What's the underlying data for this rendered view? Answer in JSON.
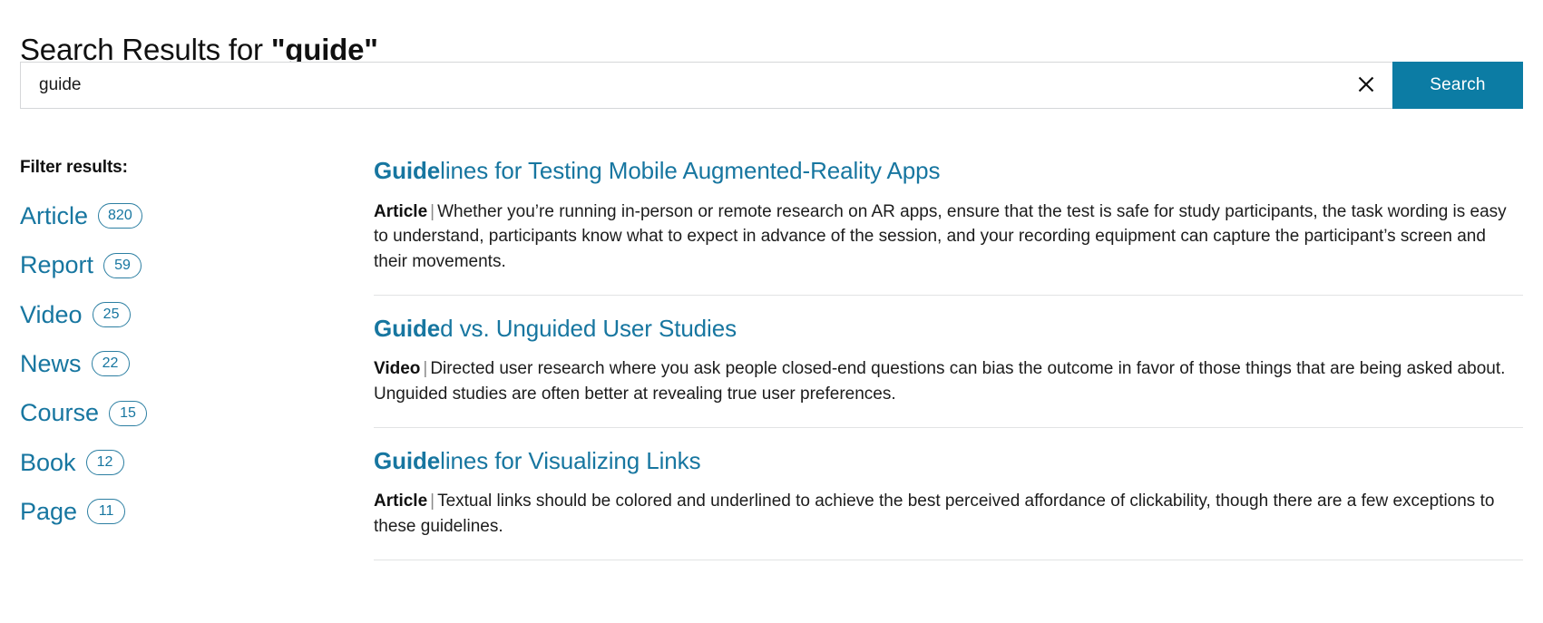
{
  "header": {
    "title_prefix": "Search Results for ",
    "query_quoted": "\"guide\""
  },
  "search": {
    "value": "guide",
    "placeholder": "Search",
    "clear_icon": "close-x-icon",
    "submit_label": "Search",
    "accent_color": "#0c7ca4"
  },
  "sidebar": {
    "heading": "Filter results:",
    "items": [
      {
        "label": "Article",
        "count": "820"
      },
      {
        "label": "Report",
        "count": "59"
      },
      {
        "label": "Video",
        "count": "25"
      },
      {
        "label": "News",
        "count": "22"
      },
      {
        "label": "Course",
        "count": "15"
      },
      {
        "label": "Book",
        "count": "12"
      },
      {
        "label": "Page",
        "count": "11"
      }
    ],
    "link_color": "#1776a0"
  },
  "results": [
    {
      "title_hit": "Guide",
      "title_rest": "lines for Testing Mobile Augmented-Reality Apps",
      "type": "Article",
      "separator": "|",
      "description": "Whether you’re running in-person or remote research on AR apps, ensure that the test is safe for study participants, the task wording is easy to understand, participants know what to expect in advance of the session, and your recording equipment can capture the participant’s screen and their movements."
    },
    {
      "title_hit": "Guide",
      "title_rest": "d vs. Unguided User Studies",
      "type": "Video",
      "separator": "|",
      "description": "Directed user research where you ask people closed-end questions can bias the outcome in favor of those things that are being asked about. Unguided studies are often better at revealing true user preferences."
    },
    {
      "title_hit": "Guide",
      "title_rest": "lines for Visualizing Links",
      "type": "Article",
      "separator": "|",
      "description": "Textual links should be colored and underlined to achieve the best perceived affordance of clickability, though there are a few exceptions to these guidelines."
    }
  ]
}
